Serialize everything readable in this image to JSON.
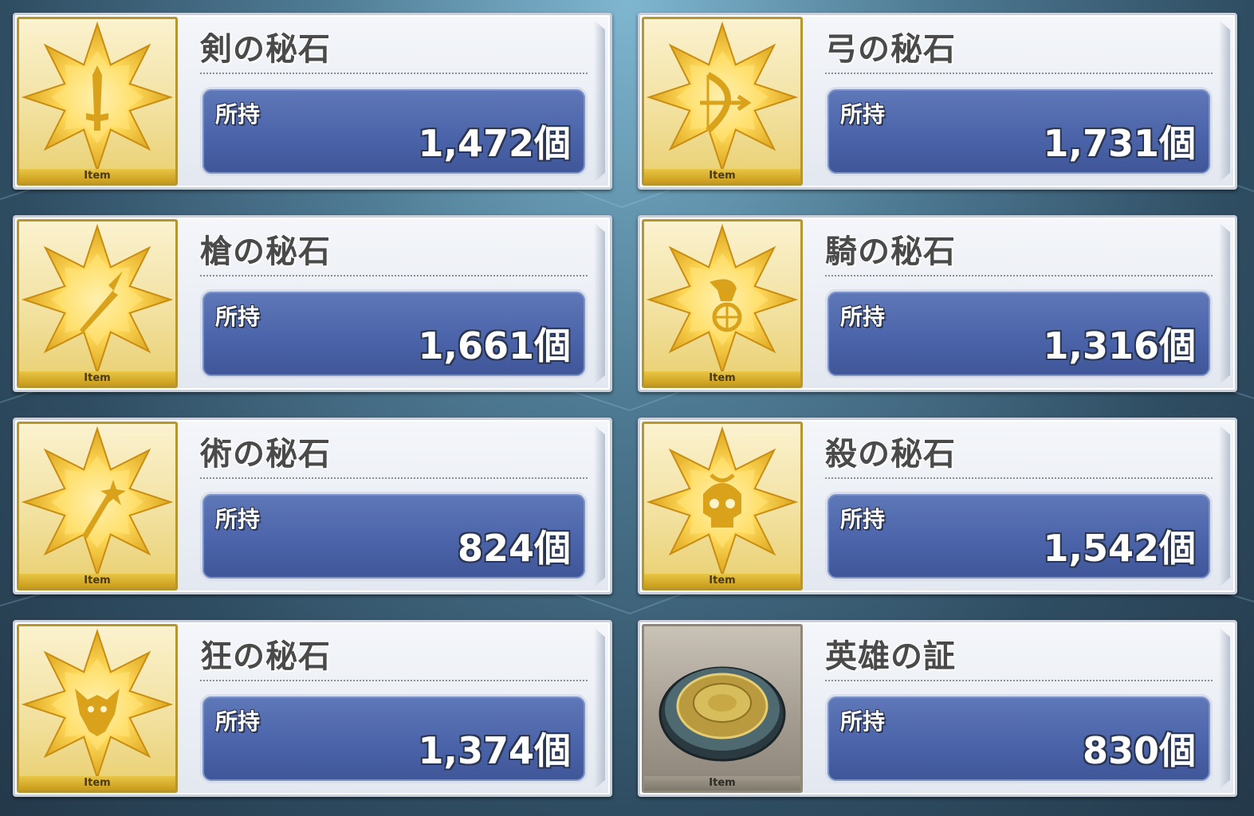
{
  "own_label": "所持",
  "item_label": "Item",
  "items": [
    {
      "name": "剣の秘石",
      "count": "1,472個",
      "emblem": "sword-icon",
      "style": "gold"
    },
    {
      "name": "弓の秘石",
      "count": "1,731個",
      "emblem": "bow-icon",
      "style": "gold"
    },
    {
      "name": "槍の秘石",
      "count": "1,661個",
      "emblem": "lance-icon",
      "style": "gold"
    },
    {
      "name": "騎の秘石",
      "count": "1,316個",
      "emblem": "horse-icon",
      "style": "gold"
    },
    {
      "name": "術の秘石",
      "count": "824個",
      "emblem": "staff-icon",
      "style": "gold"
    },
    {
      "name": "殺の秘石",
      "count": "1,542個",
      "emblem": "skull-icon",
      "style": "gold"
    },
    {
      "name": "狂の秘石",
      "count": "1,374個",
      "emblem": "beast-icon",
      "style": "gold"
    },
    {
      "name": "英雄の証",
      "count": "830個",
      "emblem": "medal-icon",
      "style": "silver"
    }
  ],
  "colors": {
    "gold_frame": "#b7962f",
    "count_panel": "#4a62a8",
    "card_bg": "#eef1f6"
  }
}
